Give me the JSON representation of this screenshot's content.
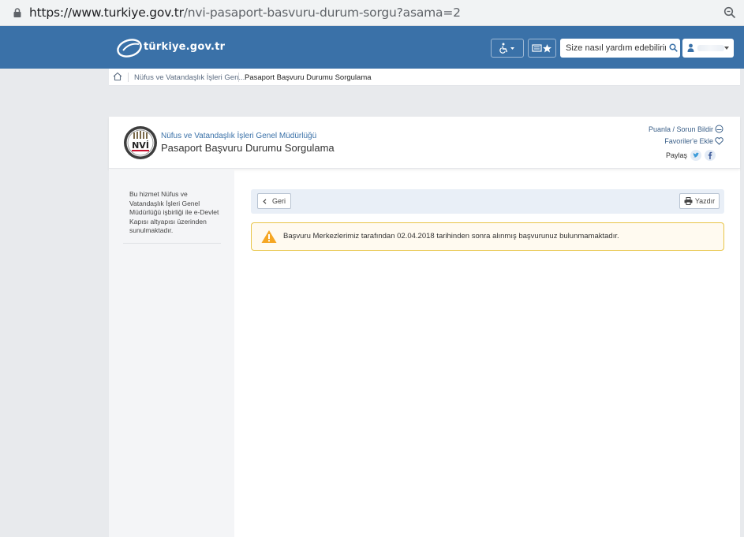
{
  "browser": {
    "url_host": "https://www.turkiye.gov.tr",
    "url_path": "/nvi-pasaport-basvuru-durum-sorgu?asama=2"
  },
  "header": {
    "logo_text": "türkiye.gov.tr",
    "search_placeholder": "Size nasıl yardım edebilirim?"
  },
  "breadcrumb": {
    "items": [
      "Nüfus ve Vatandaşlık İşleri Gen...",
      "Pasaport Başvuru Durumu Sorgulama"
    ]
  },
  "service": {
    "organization": "Nüfus ve Vatandaşlık İşleri Genel Müdürlüğü",
    "title": "Pasaport Başvuru Durumu Sorgulama",
    "logo_text": "NVİ",
    "rate_link": "Puanla / Sorun Bildir",
    "favorites_link": "Favoriler'e Ekle",
    "share_label": "Paylaş"
  },
  "sidebar": {
    "info_text": "Bu hizmet Nüfus ve Vatandaşlık İşleri Genel Müdürlüğü işbirliği ile e-Devlet Kapısı altyapısı üzerinden sunulmaktadır."
  },
  "toolbar": {
    "back_label": "Geri",
    "print_label": "Yazdır"
  },
  "alert": {
    "message": "Başvuru Merkezlerimiz tarafından 02.04.2018 tarihinden sonra alınmış başvurunuz bulunmamaktadır."
  },
  "colors": {
    "header_blue": "#3a71a8",
    "alert_border": "#e8c547",
    "warning_orange": "#f5a623"
  },
  "icons": [
    "lock-icon",
    "zoom-icon",
    "accessibility-icon",
    "favorites-icon",
    "search-icon",
    "user-icon",
    "home-icon",
    "rate-icon",
    "heart-icon",
    "twitter-icon",
    "facebook-icon",
    "back-chevron-icon",
    "print-icon",
    "warning-icon"
  ]
}
